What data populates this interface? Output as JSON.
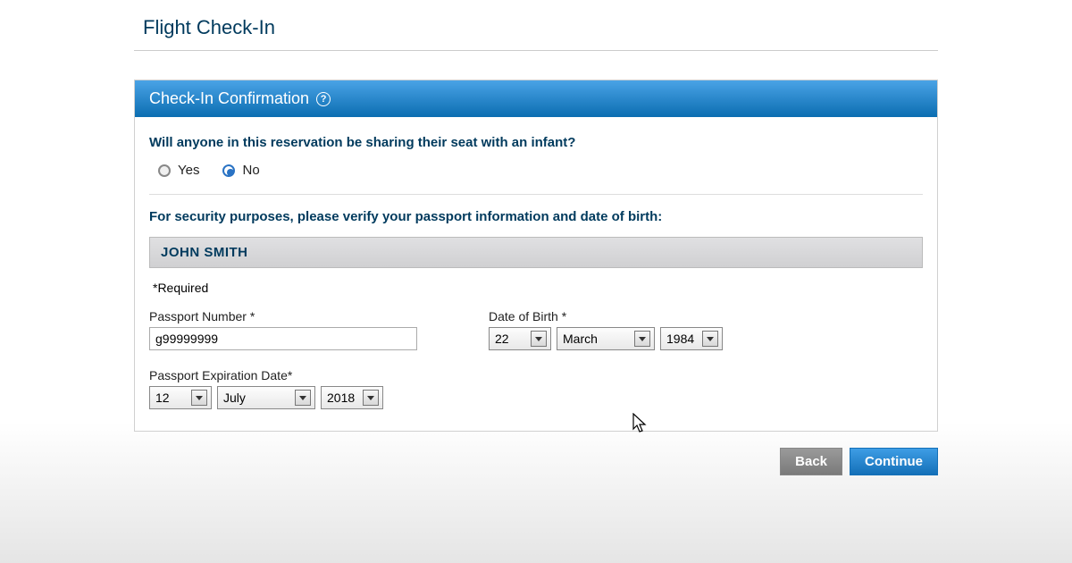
{
  "page_title": "Flight Check-In",
  "panel_title": "Check-In Confirmation",
  "infant_question": "Will anyone in this reservation be sharing their seat with an infant?",
  "radio": {
    "yes": "Yes",
    "no": "No",
    "selected": "No"
  },
  "security_text": "For security purposes, please verify your passport information and date of birth:",
  "passenger_name": "JOHN SMITH",
  "required_note": "*Required",
  "labels": {
    "passport_number": "Passport Number *",
    "dob": "Date of Birth *",
    "passport_expiration": "Passport Expiration Date*"
  },
  "values": {
    "passport_number": "g99999999",
    "dob_day": "22",
    "dob_month": "March",
    "dob_year": "1984",
    "exp_day": "12",
    "exp_month": "July",
    "exp_year": "2018"
  },
  "buttons": {
    "back": "Back",
    "continue": "Continue"
  }
}
